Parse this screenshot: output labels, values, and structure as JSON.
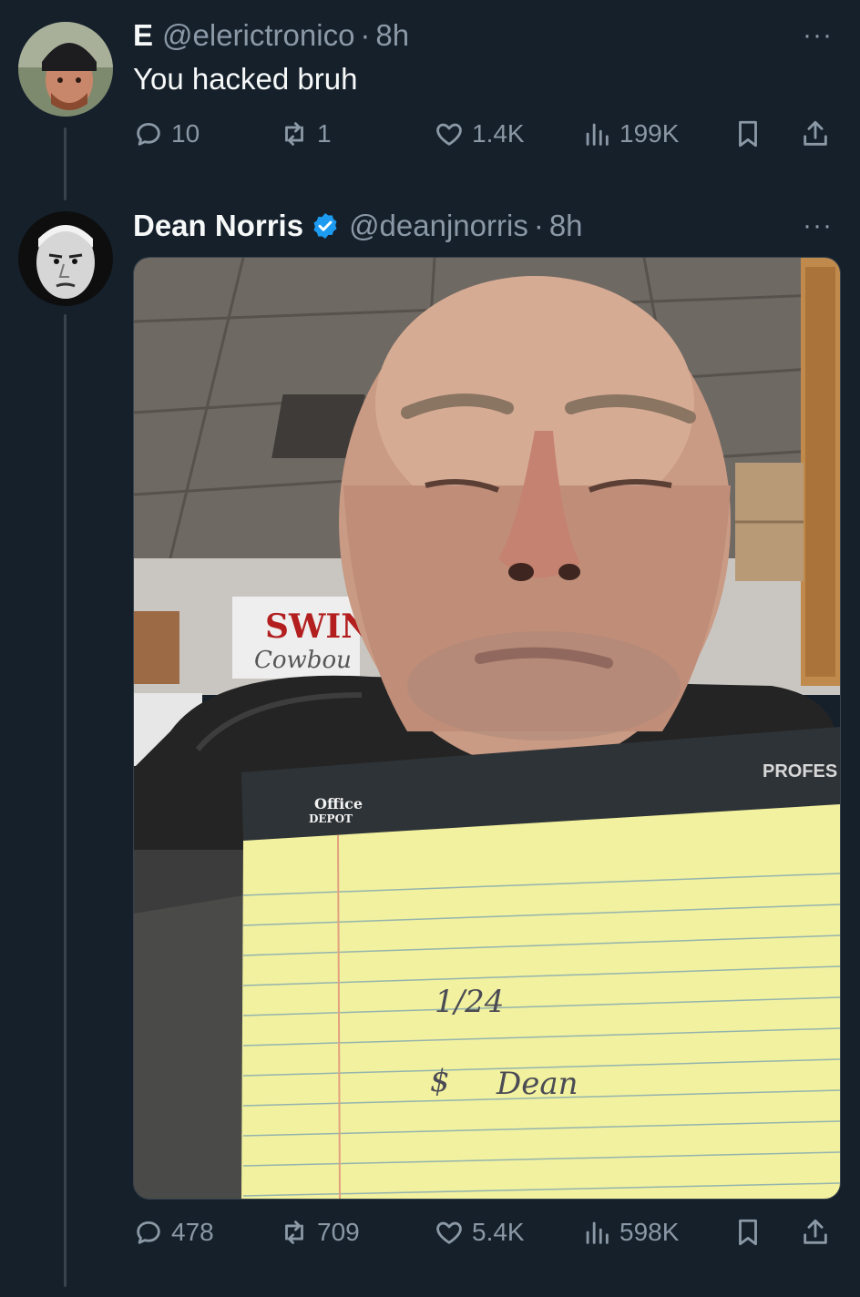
{
  "tweet1": {
    "display_name": "E",
    "handle": "@elerictronico",
    "separator": "·",
    "time": "8h",
    "text": "You hacked bruh",
    "more": "···",
    "avatar_icon": "profile-photo-icon",
    "replies": "10",
    "retweets": "1",
    "likes": "1.4K",
    "views": "199K"
  },
  "tweet2": {
    "display_name": "Dean Norris",
    "handle": "@deanjnorris",
    "separator": "·",
    "time": "8h",
    "more": "···",
    "verified_icon": "verified-badge-icon",
    "avatar_icon": "profile-photo-icon",
    "replies": "478",
    "retweets": "709",
    "likes": "5.4K",
    "views": "598K",
    "media": {
      "banner_line1": "SWIN",
      "banner_line2": "Cowbou",
      "pad_brand_line1": "Office",
      "pad_brand_line2": "DEPOT",
      "pad_label": "PROFES",
      "note_line1": "1/24",
      "note_dollar": "$",
      "note_line2": "Dean"
    }
  },
  "colors": {
    "background": "#15202b",
    "text": "#f7f9f9",
    "secondary": "#8b98a5",
    "verified": "#1d9bf0",
    "line": "#38444d"
  }
}
